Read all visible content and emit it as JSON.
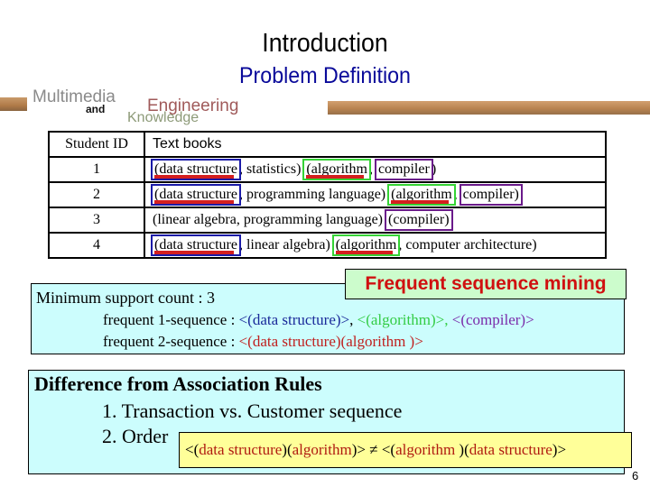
{
  "slide": {
    "title": "Introduction",
    "subtitle": "Problem Definition",
    "page_number": "6"
  },
  "logo": {
    "line1": "Multimedia",
    "line2": "and",
    "line3": "Engineering",
    "line4": "Knowledge"
  },
  "table": {
    "headers": [
      "Student ID",
      "Text books"
    ],
    "rows": [
      {
        "id": "1",
        "parts": [
          "(data structure",
          ", statistics) ",
          "(algorithm",
          ", ",
          "compiler",
          ")"
        ]
      },
      {
        "id": "2",
        "parts": [
          "(data structure",
          ", programming language) ",
          "(algorithm",
          ", ",
          "compiler)",
          ""
        ]
      },
      {
        "id": "3",
        "parts": [
          "(linear algebra, programming language) ",
          "(compiler)"
        ]
      },
      {
        "id": "4",
        "parts": [
          "(data structure",
          ", linear algebra) ",
          "(algorithm",
          ", computer architecture)"
        ]
      }
    ]
  },
  "frequent": {
    "label": "Frequent sequence mining",
    "min_support": "Minimum support count : 3",
    "seq1_label": "frequent 1-sequence : ",
    "seq1_items": [
      "<(data structure)>",
      ", ",
      "<(algorithm)>",
      ", ",
      "<(compiler)>"
    ],
    "seq2_label": "frequent 2-sequence : ",
    "seq2_value": "<(data structure)(algorithm )>",
    "colors": {
      "data_structure": "#1a2a9a",
      "algorithm": "#33cc44",
      "compiler": "#7a2aaa",
      "two_seq": "#c0201f"
    }
  },
  "difference": {
    "title": "Difference from Association Rules",
    "item1": "1. Transaction vs. Customer sequence",
    "item2": "2. Order",
    "order_example": {
      "p1": "<(",
      "p2": "data structure",
      "p3": ")(",
      "p4": "algorithm",
      "p5": ")> ≠ <(",
      "p6": "algorithm",
      "p7": " )(",
      "p8": "data structure",
      "p9": ")>"
    }
  },
  "highlight_colors": {
    "data_structure_box": "#1a1aa8",
    "algorithm_box": "#35d335",
    "compiler_box": "#6a1a8a",
    "underline": "#d41f1f"
  }
}
